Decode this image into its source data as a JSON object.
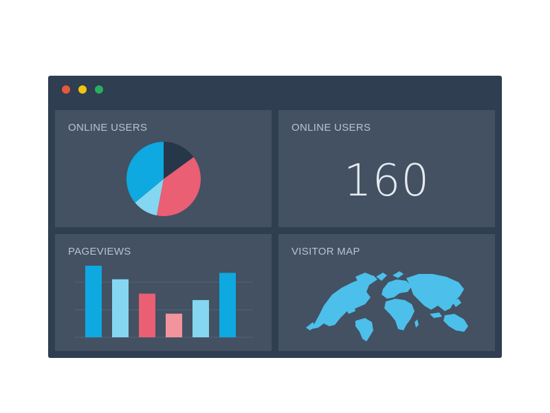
{
  "window": {
    "controls": [
      {
        "name": "close",
        "color": "#e45a3a"
      },
      {
        "name": "minimize",
        "color": "#f1c40f"
      },
      {
        "name": "maximize",
        "color": "#27ae60"
      }
    ]
  },
  "panels": {
    "pie": {
      "title": "ONLINE USERS"
    },
    "number": {
      "title": "ONLINE USERS",
      "value": "160"
    },
    "bars": {
      "title": "PAGEVIEWS"
    },
    "map": {
      "title": "VISITOR MAP",
      "map_color": "#4cc0ea"
    }
  },
  "chart_data": [
    {
      "type": "pie",
      "values": [
        15,
        38,
        11,
        36
      ],
      "colors": [
        "#26374a",
        "#ea5f73",
        "#85d6f0",
        "#0ea9e0"
      ]
    },
    {
      "type": "bar",
      "values": [
        100,
        81,
        61,
        33,
        52,
        90
      ],
      "colors": [
        "#0ea9e0",
        "#85d6f0",
        "#ea5f73",
        "#f2949d",
        "#85d6f0",
        "#0ea9e0"
      ],
      "ylim": [
        0,
        100
      ],
      "grid": true
    }
  ]
}
